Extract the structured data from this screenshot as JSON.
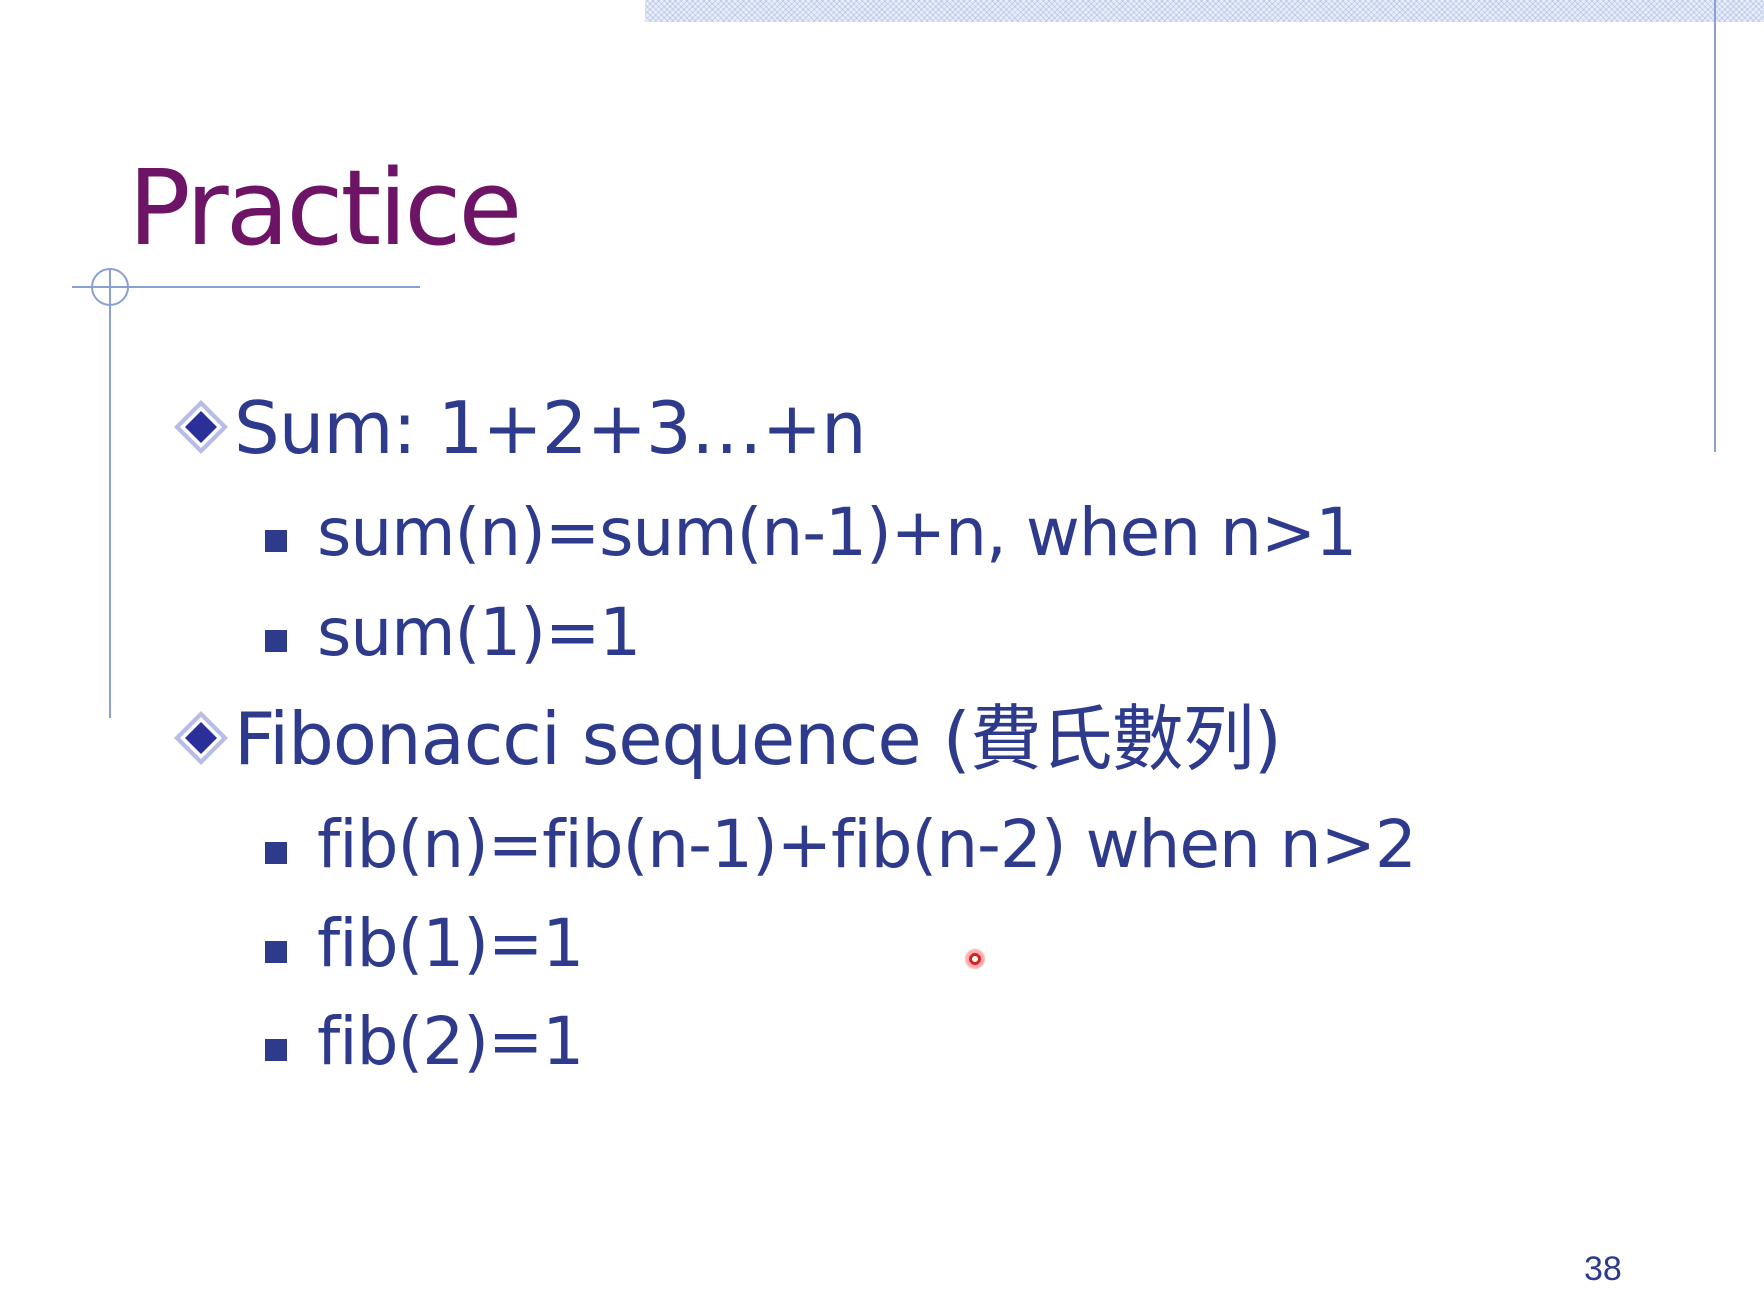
{
  "slide": {
    "title": "Practice",
    "page_number": "38",
    "colors": {
      "title": "#6e1466",
      "body_text": "#2e3b8c",
      "accent_lines": "#8a9fd6"
    }
  },
  "bullets": [
    {
      "text": "Sum: 1+2+3…+n",
      "children": [
        "sum(n)=sum(n-1)+n, when n>1",
        "sum(1)=1"
      ]
    },
    {
      "text": "Fibonacci sequence (",
      "text_cjk": "費氏數列",
      "text_end": ")",
      "children": [
        "fib(n)=fib(n-1)+fib(n-2) when n>2",
        "fib(1)=1",
        "fib(2)=1"
      ]
    }
  ],
  "icons": {
    "level1_bullet": "diamond-bullet-icon",
    "level2_bullet": "square-bullet-icon",
    "pointer": "laser-pointer-icon"
  }
}
